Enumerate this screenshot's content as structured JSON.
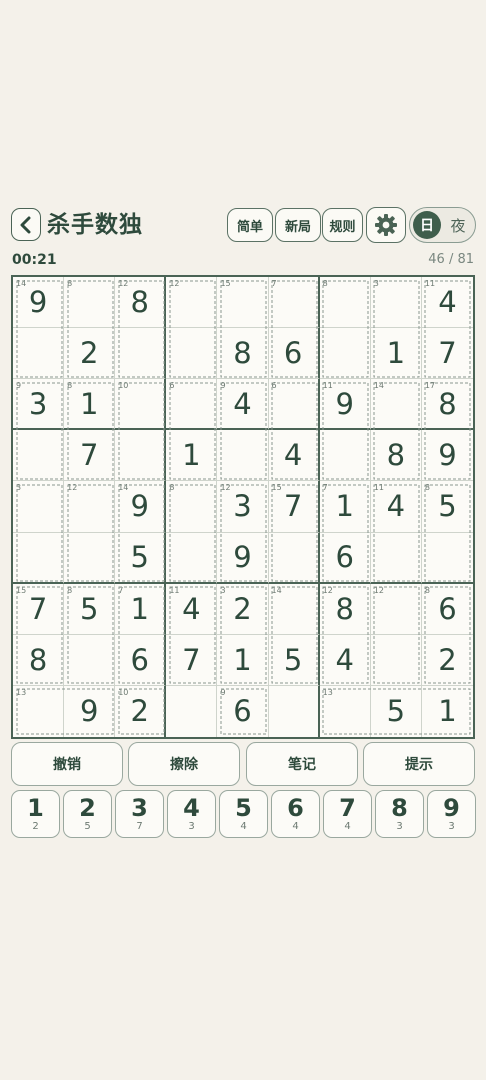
{
  "header": {
    "title": "杀手数独",
    "difficulty_label": "简单",
    "new_game_label": "新局",
    "rules_label": "规则",
    "day_label": "日",
    "night_label": "夜"
  },
  "status": {
    "timer": "00:21",
    "progress": "46 / 81"
  },
  "board": [
    [
      "9",
      "",
      "8",
      "",
      "",
      "",
      "",
      "",
      "4"
    ],
    [
      "",
      "2",
      "",
      "",
      "8",
      "6",
      "",
      "1",
      "7"
    ],
    [
      "3",
      "1",
      "",
      "",
      "4",
      "",
      "9",
      "",
      "8"
    ],
    [
      "",
      "7",
      "",
      "1",
      "",
      "4",
      "",
      "8",
      "9"
    ],
    [
      "",
      "",
      "9",
      "",
      "3",
      "7",
      "1",
      "4",
      "5"
    ],
    [
      "",
      "",
      "5",
      "",
      "9",
      "",
      "6",
      "",
      ""
    ],
    [
      "7",
      "5",
      "1",
      "4",
      "2",
      "",
      "8",
      "",
      "6"
    ],
    [
      "8",
      "",
      "6",
      "7",
      "1",
      "5",
      "4",
      "",
      "2"
    ],
    [
      "",
      "9",
      "2",
      "",
      "6",
      "",
      "",
      "5",
      "1"
    ]
  ],
  "cage_sums": [
    {
      "r": 0,
      "c": 0,
      "sum": "14"
    },
    {
      "r": 0,
      "c": 1,
      "sum": "8"
    },
    {
      "r": 0,
      "c": 2,
      "sum": "12"
    },
    {
      "r": 0,
      "c": 3,
      "sum": "12"
    },
    {
      "r": 0,
      "c": 4,
      "sum": "15"
    },
    {
      "r": 0,
      "c": 5,
      "sum": "7"
    },
    {
      "r": 0,
      "c": 6,
      "sum": "8"
    },
    {
      "r": 0,
      "c": 7,
      "sum": "3"
    },
    {
      "r": 0,
      "c": 8,
      "sum": "11"
    },
    {
      "r": 2,
      "c": 0,
      "sum": "9"
    },
    {
      "r": 2,
      "c": 1,
      "sum": "8"
    },
    {
      "r": 2,
      "c": 2,
      "sum": "10"
    },
    {
      "r": 2,
      "c": 3,
      "sum": "6"
    },
    {
      "r": 2,
      "c": 4,
      "sum": "9"
    },
    {
      "r": 2,
      "c": 5,
      "sum": "6"
    },
    {
      "r": 2,
      "c": 6,
      "sum": "11"
    },
    {
      "r": 2,
      "c": 7,
      "sum": "14"
    },
    {
      "r": 2,
      "c": 8,
      "sum": "17"
    },
    {
      "r": 4,
      "c": 0,
      "sum": "3"
    },
    {
      "r": 4,
      "c": 1,
      "sum": "12"
    },
    {
      "r": 4,
      "c": 2,
      "sum": "14"
    },
    {
      "r": 4,
      "c": 3,
      "sum": "8"
    },
    {
      "r": 4,
      "c": 4,
      "sum": "12"
    },
    {
      "r": 4,
      "c": 5,
      "sum": "15"
    },
    {
      "r": 4,
      "c": 6,
      "sum": "7"
    },
    {
      "r": 4,
      "c": 7,
      "sum": "11"
    },
    {
      "r": 4,
      "c": 8,
      "sum": "8"
    },
    {
      "r": 6,
      "c": 0,
      "sum": "15"
    },
    {
      "r": 6,
      "c": 1,
      "sum": "8"
    },
    {
      "r": 6,
      "c": 2,
      "sum": "7"
    },
    {
      "r": 6,
      "c": 3,
      "sum": "11"
    },
    {
      "r": 6,
      "c": 4,
      "sum": "3"
    },
    {
      "r": 6,
      "c": 5,
      "sum": "14"
    },
    {
      "r": 6,
      "c": 6,
      "sum": "12"
    },
    {
      "r": 6,
      "c": 7,
      "sum": "12"
    },
    {
      "r": 6,
      "c": 8,
      "sum": "8"
    },
    {
      "r": 8,
      "c": 0,
      "sum": "13"
    },
    {
      "r": 8,
      "c": 2,
      "sum": "10"
    },
    {
      "r": 8,
      "c": 4,
      "sum": "9"
    },
    {
      "r": 8,
      "c": 6,
      "sum": "13"
    }
  ],
  "actions": {
    "undo": "撤销",
    "erase": "擦除",
    "notes": "笔记",
    "hint": "提示"
  },
  "numpad": [
    {
      "n": "1",
      "count": "2"
    },
    {
      "n": "2",
      "count": "5"
    },
    {
      "n": "3",
      "count": "7"
    },
    {
      "n": "4",
      "count": "3"
    },
    {
      "n": "5",
      "count": "4"
    },
    {
      "n": "6",
      "count": "4"
    },
    {
      "n": "7",
      "count": "4"
    },
    {
      "n": "8",
      "count": "3"
    },
    {
      "n": "9",
      "count": "3"
    }
  ],
  "colors": {
    "accent": "#3f5e4c",
    "background": "#f4f1ea",
    "cell_background": "#fcfbf7",
    "text": "#2e4a3c"
  }
}
